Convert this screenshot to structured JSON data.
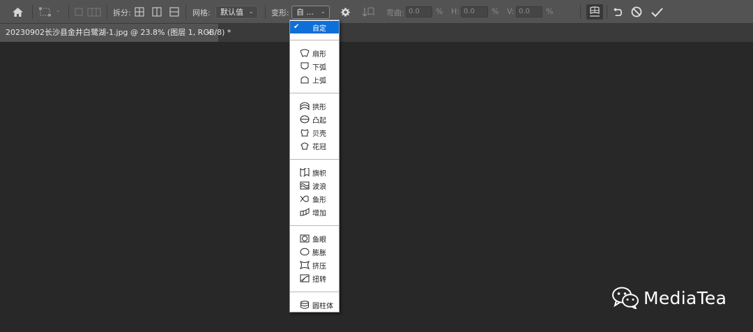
{
  "toolbar": {
    "split_label": "拆分:",
    "grid_label": "网格:",
    "grid_value": "默认值",
    "warp_label": "变形:",
    "warp_value": "自 ...",
    "bend_label": "弯曲:",
    "bend_value": "0.0",
    "bend_unit": "%",
    "h_label": "H:",
    "h_value": "0.0",
    "h_unit": "%",
    "v_label": "V:",
    "v_value": "0.0",
    "v_unit": "%"
  },
  "document_tab": {
    "title": "20230902长沙县金井白鹭湖-1.jpg @ 23.8% (图层 1, RGB/8) *",
    "close": "×"
  },
  "warp_menu": {
    "selected": "自定",
    "groups": [
      [
        "扇形",
        "下弧",
        "上弧"
      ],
      [
        "拱形",
        "凸起",
        "贝壳",
        "花冠"
      ],
      [
        "旗帜",
        "波浪",
        "鱼形",
        "增加"
      ],
      [
        "鱼眼",
        "膨胀",
        "挤压",
        "扭转"
      ],
      [
        "圆柱体"
      ]
    ]
  },
  "watermark": {
    "text": "MediaTea"
  },
  "colors": {
    "selection": "#0f6fd8",
    "canvas": "#282828",
    "optbar": "#535353"
  }
}
